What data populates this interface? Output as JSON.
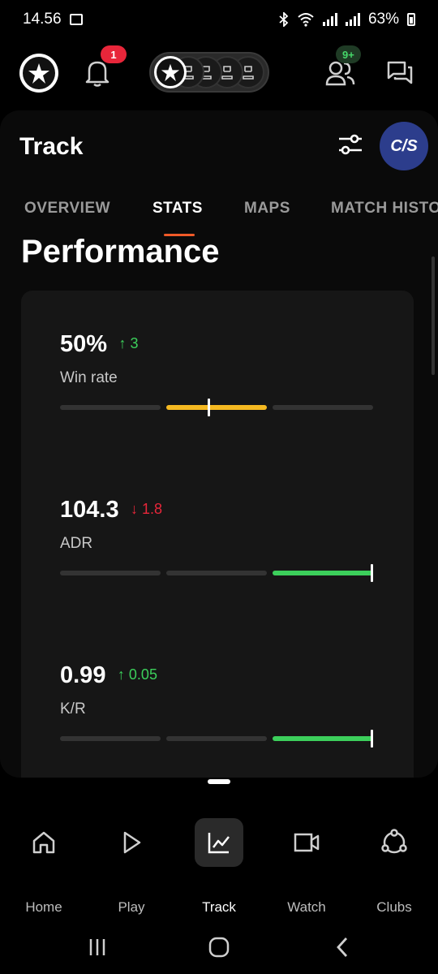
{
  "status_bar": {
    "time": "14.56",
    "battery": "63%"
  },
  "header": {
    "notification_count": "1",
    "friends_badge": "9+"
  },
  "page": {
    "title": "Track",
    "game_badge": "C/S",
    "tabs": [
      {
        "label": "OVERVIEW",
        "active": false
      },
      {
        "label": "STATS",
        "active": true
      },
      {
        "label": "MAPS",
        "active": false
      },
      {
        "label": "MATCH HISTO",
        "active": false
      }
    ],
    "section_title": "Performance"
  },
  "stats": [
    {
      "value": "50%",
      "delta_arrow": "↑",
      "delta": "3",
      "trend": "up",
      "label": "Win rate",
      "level": 0.47,
      "highlight_segment": 2,
      "color": "#f5b921"
    },
    {
      "value": "104.3",
      "delta_arrow": "↓",
      "delta": "1.8",
      "trend": "down",
      "label": "ADR",
      "level": 1.0,
      "highlight_segment": 3,
      "color": "#3ccf5b"
    },
    {
      "value": "0.99",
      "delta_arrow": "↑",
      "delta": "0.05",
      "trend": "up",
      "label": "K/R",
      "level": 1.0,
      "highlight_segment": 3,
      "color": "#3ccf5b"
    }
  ],
  "bottom_nav": [
    {
      "label": "Home",
      "icon": "home-icon",
      "active": false
    },
    {
      "label": "Play",
      "icon": "play-icon",
      "active": false
    },
    {
      "label": "Track",
      "icon": "chart-icon",
      "active": true
    },
    {
      "label": "Watch",
      "icon": "video-icon",
      "active": false
    },
    {
      "label": "Clubs",
      "icon": "clubs-icon",
      "active": false
    }
  ],
  "colors": {
    "accent": "#f05a28",
    "positive": "#3ccf5b",
    "negative": "#e8263a",
    "warning": "#f5b921"
  }
}
